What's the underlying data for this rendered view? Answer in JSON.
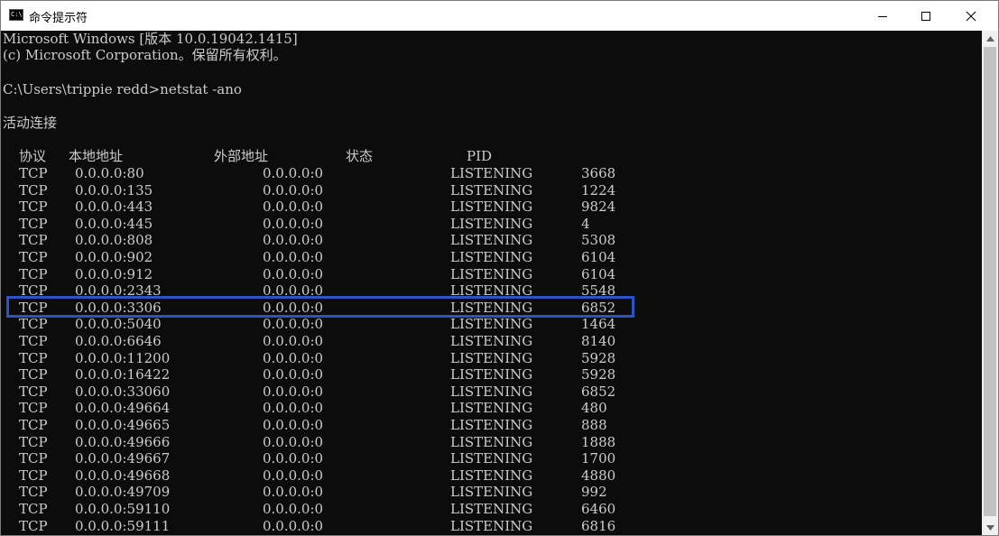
{
  "window": {
    "title": "命令提示符",
    "icon": "console-icon",
    "icon_text": "C:\\"
  },
  "console": {
    "header_lines": [
      "Microsoft Windows [版本 10.0.19042.1415]",
      "(c) Microsoft Corporation。保留所有权利。",
      "",
      "C:\\Users\\trippie redd>netstat -ano",
      "",
      "活动连接"
    ],
    "columns": [
      "协议",
      "本地地址",
      "外部地址",
      "状态",
      "PID"
    ],
    "rows": [
      {
        "proto": "TCP",
        "local": "0.0.0.0:80",
        "foreign": "0.0.0.0:0",
        "state": "LISTENING",
        "pid": "3668"
      },
      {
        "proto": "TCP",
        "local": "0.0.0.0:135",
        "foreign": "0.0.0.0:0",
        "state": "LISTENING",
        "pid": "1224"
      },
      {
        "proto": "TCP",
        "local": "0.0.0.0:443",
        "foreign": "0.0.0.0:0",
        "state": "LISTENING",
        "pid": "9824"
      },
      {
        "proto": "TCP",
        "local": "0.0.0.0:445",
        "foreign": "0.0.0.0:0",
        "state": "LISTENING",
        "pid": "4"
      },
      {
        "proto": "TCP",
        "local": "0.0.0.0:808",
        "foreign": "0.0.0.0:0",
        "state": "LISTENING",
        "pid": "5308"
      },
      {
        "proto": "TCP",
        "local": "0.0.0.0:902",
        "foreign": "0.0.0.0:0",
        "state": "LISTENING",
        "pid": "6104"
      },
      {
        "proto": "TCP",
        "local": "0.0.0.0:912",
        "foreign": "0.0.0.0:0",
        "state": "LISTENING",
        "pid": "6104"
      },
      {
        "proto": "TCP",
        "local": "0.0.0.0:2343",
        "foreign": "0.0.0.0:0",
        "state": "LISTENING",
        "pid": "5548"
      },
      {
        "proto": "TCP",
        "local": "0.0.0.0:3306",
        "foreign": "0.0.0.0:0",
        "state": "LISTENING",
        "pid": "6852",
        "highlighted": true
      },
      {
        "proto": "TCP",
        "local": "0.0.0.0:5040",
        "foreign": "0.0.0.0:0",
        "state": "LISTENING",
        "pid": "1464"
      },
      {
        "proto": "TCP",
        "local": "0.0.0.0:6646",
        "foreign": "0.0.0.0:0",
        "state": "LISTENING",
        "pid": "8140"
      },
      {
        "proto": "TCP",
        "local": "0.0.0.0:11200",
        "foreign": "0.0.0.0:0",
        "state": "LISTENING",
        "pid": "5928"
      },
      {
        "proto": "TCP",
        "local": "0.0.0.0:16422",
        "foreign": "0.0.0.0:0",
        "state": "LISTENING",
        "pid": "5928"
      },
      {
        "proto": "TCP",
        "local": "0.0.0.0:33060",
        "foreign": "0.0.0.0:0",
        "state": "LISTENING",
        "pid": "6852"
      },
      {
        "proto": "TCP",
        "local": "0.0.0.0:49664",
        "foreign": "0.0.0.0:0",
        "state": "LISTENING",
        "pid": "480"
      },
      {
        "proto": "TCP",
        "local": "0.0.0.0:49665",
        "foreign": "0.0.0.0:0",
        "state": "LISTENING",
        "pid": "888"
      },
      {
        "proto": "TCP",
        "local": "0.0.0.0:49666",
        "foreign": "0.0.0.0:0",
        "state": "LISTENING",
        "pid": "1888"
      },
      {
        "proto": "TCP",
        "local": "0.0.0.0:49667",
        "foreign": "0.0.0.0:0",
        "state": "LISTENING",
        "pid": "1700"
      },
      {
        "proto": "TCP",
        "local": "0.0.0.0:49668",
        "foreign": "0.0.0.0:0",
        "state": "LISTENING",
        "pid": "4880"
      },
      {
        "proto": "TCP",
        "local": "0.0.0.0:49709",
        "foreign": "0.0.0.0:0",
        "state": "LISTENING",
        "pid": "992"
      },
      {
        "proto": "TCP",
        "local": "0.0.0.0:59110",
        "foreign": "0.0.0.0:0",
        "state": "LISTENING",
        "pid": "6460"
      },
      {
        "proto": "TCP",
        "local": "0.0.0.0:59111",
        "foreign": "0.0.0.0:0",
        "state": "LISTENING",
        "pid": "6816"
      }
    ]
  },
  "colors": {
    "console_bg": "#0c0c0c",
    "console_text": "#cccccc",
    "highlight_border": "#2a53c5",
    "titlebar_bg": "#ffffff"
  },
  "icons": {
    "minimize": "minimize-icon",
    "maximize": "maximize-icon",
    "close": "close-icon",
    "scroll_up": "scroll-up-arrow-icon",
    "scroll_down": "scroll-down-arrow-icon"
  }
}
